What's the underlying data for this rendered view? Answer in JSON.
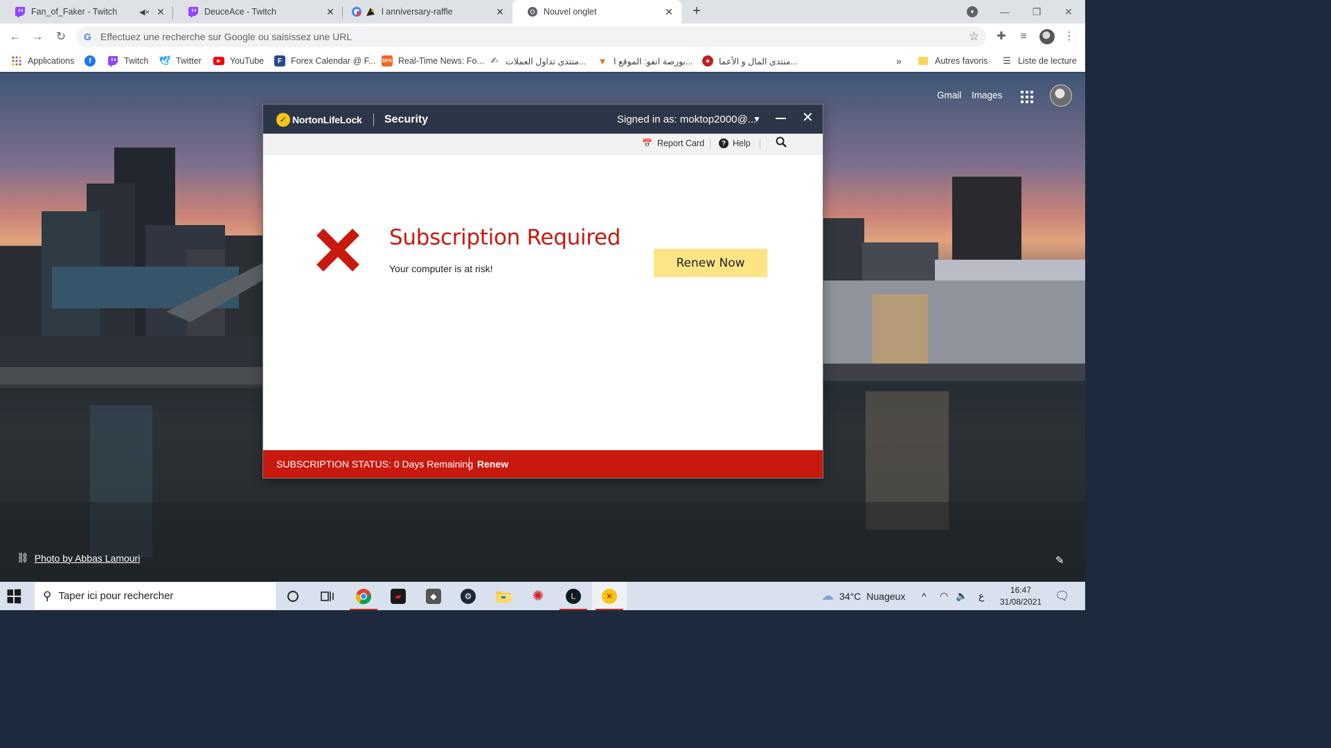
{
  "browser": {
    "tabs": [
      {
        "title": "Fan_of_Faker - Twitch",
        "icon": "twitch-icon",
        "muted": true
      },
      {
        "title": "DeuceAce - Twitch",
        "icon": "twitch-icon"
      },
      {
        "title": "l anniversary-raffle",
        "icon": "raffle-icon"
      },
      {
        "title": "Nouvel onglet",
        "icon": "chrome-icon",
        "active": true
      }
    ],
    "new_tab_label": "+",
    "omnibox_placeholder": "Effectuez une recherche sur Google ou saisissez une URL",
    "bookmarks": [
      {
        "label": "Applications",
        "icon": "apps-grid-icon"
      },
      {
        "label": "",
        "icon": "facebook-icon"
      },
      {
        "label": "Twitch",
        "icon": "twitch-icon"
      },
      {
        "label": "Twitter",
        "icon": "twitter-icon"
      },
      {
        "label": "YouTube",
        "icon": "youtube-icon"
      },
      {
        "label": "Forex Calendar @ F...",
        "icon": "forex-factory-icon"
      },
      {
        "label": "Real-Time News: Fo...",
        "icon": "dfx-icon"
      },
      {
        "label": "منتدى تداول العملات...",
        "icon": "forum-icon"
      },
      {
        "label": "بورصة انفو: الموقع ا...",
        "icon": "bourse-icon"
      },
      {
        "label": "منتدى المال و الأعما...",
        "icon": "money-forum-icon"
      }
    ],
    "bookmarks_overflow": "»",
    "other_bookmarks": "Autres favoris",
    "reading_list": "Liste de lecture"
  },
  "newtab": {
    "gmail": "Gmail",
    "images": "Images",
    "photo_credit": "Photo by Abbas Lamouri"
  },
  "norton": {
    "brand": "NortonLifeLock",
    "product": "Security",
    "signed_in": "Signed in as: moktop2000@...",
    "menu": {
      "report_card": "Report Card",
      "help": "Help"
    },
    "headline": "Subscription Required",
    "subtext": "Your computer is at risk!",
    "renew_button": "Renew Now",
    "status_label": "SUBSCRIPTION STATUS:",
    "status_value": "0 Days Remaining",
    "status_renew": "Renew",
    "colors": {
      "titlebar": "#2b3648",
      "alert_red": "#c8190e",
      "button_yellow": "#fde586"
    }
  },
  "taskbar": {
    "search_placeholder": "Taper ici pour rechercher",
    "apps": [
      "cortana-icon",
      "task-view-icon",
      "chrome-icon",
      "red-app-icon",
      "cube-app-icon",
      "steam-icon",
      "file-explorer-icon",
      "huawei-icon",
      "league-of-legends-icon",
      "norton-icon"
    ],
    "weather_temp": "34°C",
    "weather_desc": "Nuageux",
    "input_lang": "ع",
    "time": "16:47",
    "date": "31/08/2021"
  }
}
